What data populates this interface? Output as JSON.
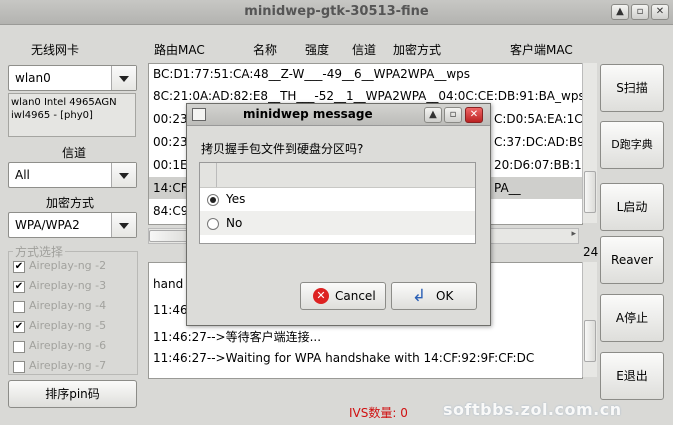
{
  "window": {
    "title": "minidwep-gtk-30513-fine"
  },
  "left": {
    "nic_label": "无线网卡",
    "nic_value": "wlan0",
    "nic_info_line1": "wlan0 Intel 4965AGN",
    "nic_info_line2": "iwl4965 - [phy0]",
    "channel_label": "信道",
    "channel_value": "All",
    "enc_label": "加密方式",
    "enc_value": "WPA/WPA2",
    "methods_label": "方式选择",
    "methods": [
      {
        "label": "Aireplay-ng -2",
        "checked": true
      },
      {
        "label": "Aireplay-ng -3",
        "checked": true
      },
      {
        "label": "Aireplay-ng -4",
        "checked": false
      },
      {
        "label": "Aireplay-ng -5",
        "checked": true
      },
      {
        "label": "Aireplay-ng -6",
        "checked": false
      },
      {
        "label": "Aireplay-ng -7",
        "checked": false
      }
    ],
    "sort_pin_label": "排序pin码"
  },
  "table_headers": [
    "路由MAC",
    "名称",
    "强度",
    "信道",
    "加密方式",
    "客户端MAC"
  ],
  "ap_rows": [
    "BC:D1:77:51:CA:48__Z-W___-49__6__WPA2WPA__wps",
    "8C:21:0A:AD:82:E8__TH___-52__1__WPA2WPA__04:0C:CE:DB:91:BA_wps",
    "00:23",
    "00:23",
    "00:1E",
    "14:CF",
    "84:C9"
  ],
  "ap_rows_right": [
    "",
    "",
    "C:D0:5A:EA:1C",
    "C:37:DC:AD:B9:2",
    "20:D6:07:BB:11:",
    "PA__",
    ""
  ],
  "log_lines": [
    "hand",
    "11:46",
    "11:46:27-->等待客户端连接...",
    "11:46:27-->Waiting for WPA handshake with 14:CF:92:9F:CF:DC"
  ],
  "counter_right": "24",
  "ivs_label": "IVS数量: 0",
  "buttons": {
    "scan": "S扫描",
    "dict": "D跑字典",
    "launch": "L启动",
    "reaver": "Reaver",
    "stop": "A停止",
    "exit": "E退出"
  },
  "dialog": {
    "title": "minidwep message",
    "question": "拷贝握手包文件到硬盘分区吗?",
    "options": [
      "Yes",
      "No"
    ],
    "selected": "Yes",
    "cancel_label": "Cancel",
    "ok_label": "OK"
  },
  "watermark": "softbbs.zol.com.cn"
}
